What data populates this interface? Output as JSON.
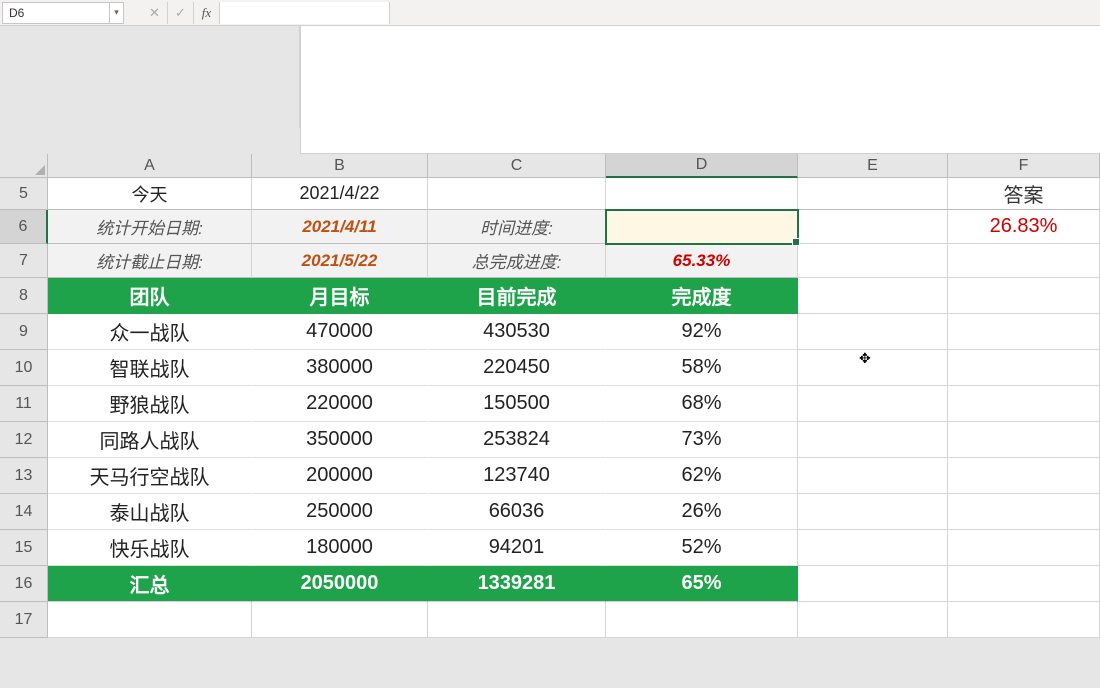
{
  "name_box": "D6",
  "formula": "",
  "columns": [
    "A",
    "B",
    "C",
    "D",
    "E",
    "F"
  ],
  "row_numbers": [
    "5",
    "6",
    "7",
    "8",
    "9",
    "10",
    "11",
    "12",
    "13",
    "14",
    "15",
    "16",
    "17"
  ],
  "cells": {
    "r5": {
      "A": "今天",
      "B": "2021/4/22",
      "F": "答案"
    },
    "r6": {
      "A": "统计开始日期:",
      "B": "2021/4/11",
      "C": "时间进度:",
      "D": "",
      "F": "26.83%"
    },
    "r7": {
      "A": "统计截止日期:",
      "B": "2021/5/22",
      "C": "总完成进度:",
      "D": "65.33%"
    }
  },
  "table_headers": {
    "A": "团队",
    "B": "月目标",
    "C": "目前完成",
    "D": "完成度"
  },
  "table_rows": [
    {
      "team": "众一战队",
      "target": "470000",
      "done": "430530",
      "pct": "92%"
    },
    {
      "team": "智联战队",
      "target": "380000",
      "done": "220450",
      "pct": "58%"
    },
    {
      "team": "野狼战队",
      "target": "220000",
      "done": "150500",
      "pct": "68%"
    },
    {
      "team": "同路人战队",
      "target": "350000",
      "done": "253824",
      "pct": "73%"
    },
    {
      "team": "天马行空战队",
      "target": "200000",
      "done": "123740",
      "pct": "62%"
    },
    {
      "team": "泰山战队",
      "target": "250000",
      "done": "66036",
      "pct": "26%"
    },
    {
      "team": "快乐战队",
      "target": "180000",
      "done": "94201",
      "pct": "52%"
    }
  ],
  "summary": {
    "label": "汇总",
    "target": "2050000",
    "done": "1339281",
    "pct": "65%"
  },
  "active_cell": "D6"
}
